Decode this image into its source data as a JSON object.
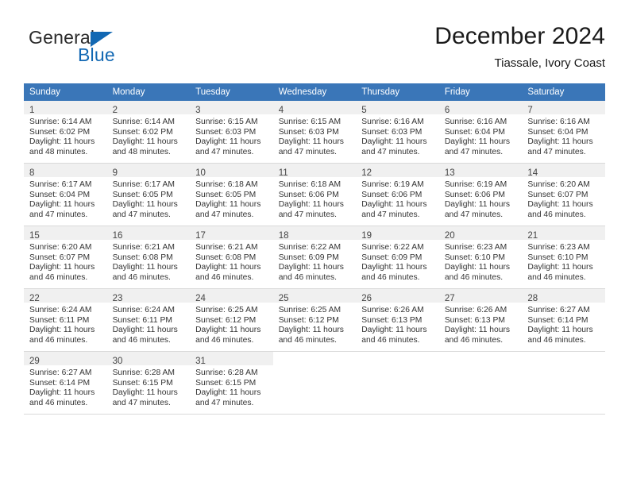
{
  "brand": {
    "name_part1": "General",
    "name_part2": "Blue"
  },
  "header": {
    "month_title": "December 2024",
    "location": "Tiassale, Ivory Coast"
  },
  "colors": {
    "header_blue": "#3a76b8",
    "brand_blue": "#1268b3",
    "daynum_band": "#f0f0f0",
    "grid_line": "#d9d9d9"
  },
  "weekday_headers": [
    "Sunday",
    "Monday",
    "Tuesday",
    "Wednesday",
    "Thursday",
    "Friday",
    "Saturday"
  ],
  "weeks": [
    [
      {
        "day": "1",
        "sunrise": "Sunrise: 6:14 AM",
        "sunset": "Sunset: 6:02 PM",
        "daylight1": "Daylight: 11 hours",
        "daylight2": "and 48 minutes."
      },
      {
        "day": "2",
        "sunrise": "Sunrise: 6:14 AM",
        "sunset": "Sunset: 6:02 PM",
        "daylight1": "Daylight: 11 hours",
        "daylight2": "and 48 minutes."
      },
      {
        "day": "3",
        "sunrise": "Sunrise: 6:15 AM",
        "sunset": "Sunset: 6:03 PM",
        "daylight1": "Daylight: 11 hours",
        "daylight2": "and 47 minutes."
      },
      {
        "day": "4",
        "sunrise": "Sunrise: 6:15 AM",
        "sunset": "Sunset: 6:03 PM",
        "daylight1": "Daylight: 11 hours",
        "daylight2": "and 47 minutes."
      },
      {
        "day": "5",
        "sunrise": "Sunrise: 6:16 AM",
        "sunset": "Sunset: 6:03 PM",
        "daylight1": "Daylight: 11 hours",
        "daylight2": "and 47 minutes."
      },
      {
        "day": "6",
        "sunrise": "Sunrise: 6:16 AM",
        "sunset": "Sunset: 6:04 PM",
        "daylight1": "Daylight: 11 hours",
        "daylight2": "and 47 minutes."
      },
      {
        "day": "7",
        "sunrise": "Sunrise: 6:16 AM",
        "sunset": "Sunset: 6:04 PM",
        "daylight1": "Daylight: 11 hours",
        "daylight2": "and 47 minutes."
      }
    ],
    [
      {
        "day": "8",
        "sunrise": "Sunrise: 6:17 AM",
        "sunset": "Sunset: 6:04 PM",
        "daylight1": "Daylight: 11 hours",
        "daylight2": "and 47 minutes."
      },
      {
        "day": "9",
        "sunrise": "Sunrise: 6:17 AM",
        "sunset": "Sunset: 6:05 PM",
        "daylight1": "Daylight: 11 hours",
        "daylight2": "and 47 minutes."
      },
      {
        "day": "10",
        "sunrise": "Sunrise: 6:18 AM",
        "sunset": "Sunset: 6:05 PM",
        "daylight1": "Daylight: 11 hours",
        "daylight2": "and 47 minutes."
      },
      {
        "day": "11",
        "sunrise": "Sunrise: 6:18 AM",
        "sunset": "Sunset: 6:06 PM",
        "daylight1": "Daylight: 11 hours",
        "daylight2": "and 47 minutes."
      },
      {
        "day": "12",
        "sunrise": "Sunrise: 6:19 AM",
        "sunset": "Sunset: 6:06 PM",
        "daylight1": "Daylight: 11 hours",
        "daylight2": "and 47 minutes."
      },
      {
        "day": "13",
        "sunrise": "Sunrise: 6:19 AM",
        "sunset": "Sunset: 6:06 PM",
        "daylight1": "Daylight: 11 hours",
        "daylight2": "and 47 minutes."
      },
      {
        "day": "14",
        "sunrise": "Sunrise: 6:20 AM",
        "sunset": "Sunset: 6:07 PM",
        "daylight1": "Daylight: 11 hours",
        "daylight2": "and 46 minutes."
      }
    ],
    [
      {
        "day": "15",
        "sunrise": "Sunrise: 6:20 AM",
        "sunset": "Sunset: 6:07 PM",
        "daylight1": "Daylight: 11 hours",
        "daylight2": "and 46 minutes."
      },
      {
        "day": "16",
        "sunrise": "Sunrise: 6:21 AM",
        "sunset": "Sunset: 6:08 PM",
        "daylight1": "Daylight: 11 hours",
        "daylight2": "and 46 minutes."
      },
      {
        "day": "17",
        "sunrise": "Sunrise: 6:21 AM",
        "sunset": "Sunset: 6:08 PM",
        "daylight1": "Daylight: 11 hours",
        "daylight2": "and 46 minutes."
      },
      {
        "day": "18",
        "sunrise": "Sunrise: 6:22 AM",
        "sunset": "Sunset: 6:09 PM",
        "daylight1": "Daylight: 11 hours",
        "daylight2": "and 46 minutes."
      },
      {
        "day": "19",
        "sunrise": "Sunrise: 6:22 AM",
        "sunset": "Sunset: 6:09 PM",
        "daylight1": "Daylight: 11 hours",
        "daylight2": "and 46 minutes."
      },
      {
        "day": "20",
        "sunrise": "Sunrise: 6:23 AM",
        "sunset": "Sunset: 6:10 PM",
        "daylight1": "Daylight: 11 hours",
        "daylight2": "and 46 minutes."
      },
      {
        "day": "21",
        "sunrise": "Sunrise: 6:23 AM",
        "sunset": "Sunset: 6:10 PM",
        "daylight1": "Daylight: 11 hours",
        "daylight2": "and 46 minutes."
      }
    ],
    [
      {
        "day": "22",
        "sunrise": "Sunrise: 6:24 AM",
        "sunset": "Sunset: 6:11 PM",
        "daylight1": "Daylight: 11 hours",
        "daylight2": "and 46 minutes."
      },
      {
        "day": "23",
        "sunrise": "Sunrise: 6:24 AM",
        "sunset": "Sunset: 6:11 PM",
        "daylight1": "Daylight: 11 hours",
        "daylight2": "and 46 minutes."
      },
      {
        "day": "24",
        "sunrise": "Sunrise: 6:25 AM",
        "sunset": "Sunset: 6:12 PM",
        "daylight1": "Daylight: 11 hours",
        "daylight2": "and 46 minutes."
      },
      {
        "day": "25",
        "sunrise": "Sunrise: 6:25 AM",
        "sunset": "Sunset: 6:12 PM",
        "daylight1": "Daylight: 11 hours",
        "daylight2": "and 46 minutes."
      },
      {
        "day": "26",
        "sunrise": "Sunrise: 6:26 AM",
        "sunset": "Sunset: 6:13 PM",
        "daylight1": "Daylight: 11 hours",
        "daylight2": "and 46 minutes."
      },
      {
        "day": "27",
        "sunrise": "Sunrise: 6:26 AM",
        "sunset": "Sunset: 6:13 PM",
        "daylight1": "Daylight: 11 hours",
        "daylight2": "and 46 minutes."
      },
      {
        "day": "28",
        "sunrise": "Sunrise: 6:27 AM",
        "sunset": "Sunset: 6:14 PM",
        "daylight1": "Daylight: 11 hours",
        "daylight2": "and 46 minutes."
      }
    ],
    [
      {
        "day": "29",
        "sunrise": "Sunrise: 6:27 AM",
        "sunset": "Sunset: 6:14 PM",
        "daylight1": "Daylight: 11 hours",
        "daylight2": "and 46 minutes."
      },
      {
        "day": "30",
        "sunrise": "Sunrise: 6:28 AM",
        "sunset": "Sunset: 6:15 PM",
        "daylight1": "Daylight: 11 hours",
        "daylight2": "and 47 minutes."
      },
      {
        "day": "31",
        "sunrise": "Sunrise: 6:28 AM",
        "sunset": "Sunset: 6:15 PM",
        "daylight1": "Daylight: 11 hours",
        "daylight2": "and 47 minutes."
      },
      null,
      null,
      null,
      null
    ]
  ]
}
